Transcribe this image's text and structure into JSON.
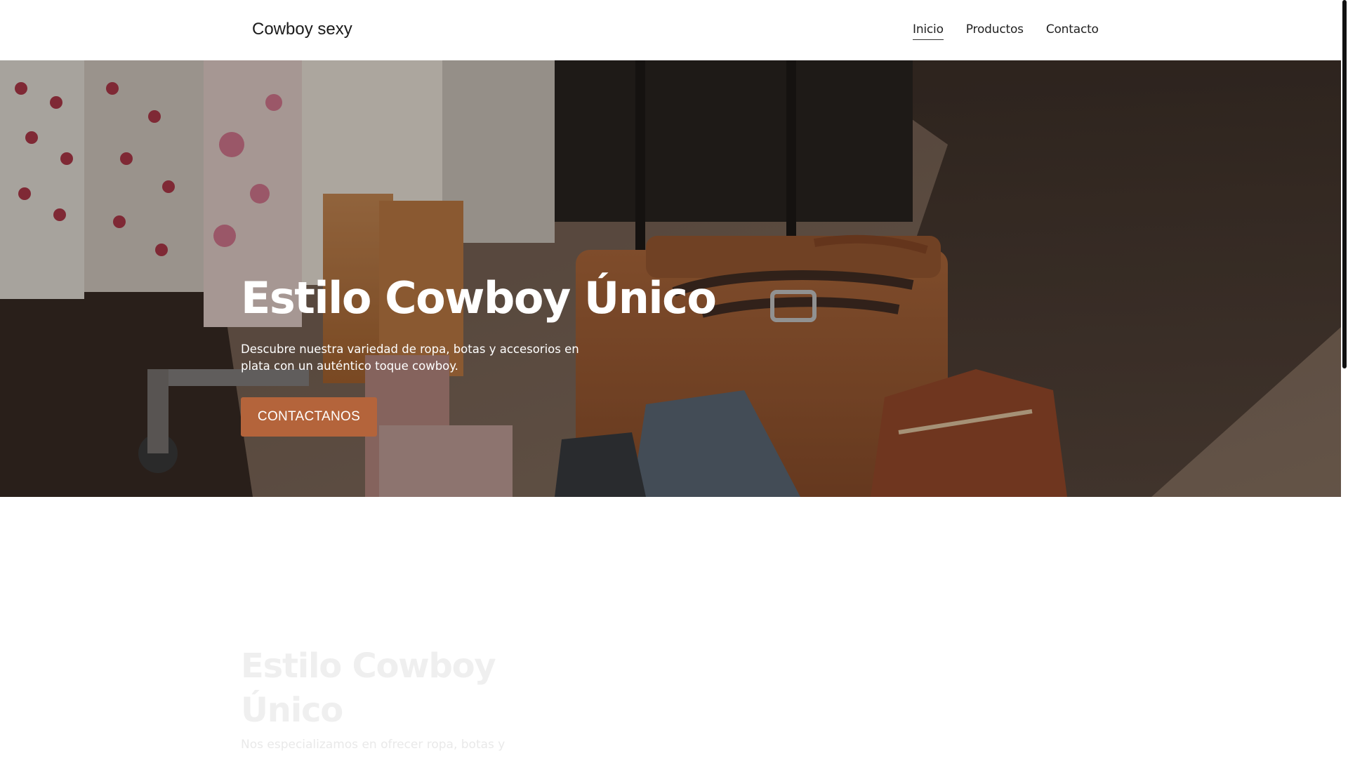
{
  "header": {
    "brand": "Cowboy sexy",
    "nav": [
      {
        "label": "Inicio",
        "active": true
      },
      {
        "label": "Productos",
        "active": false
      },
      {
        "label": "Contacto",
        "active": false
      }
    ]
  },
  "hero": {
    "title": "Estilo Cowboy Único",
    "description": "Descubre nuestra variedad de ropa, botas y accesorios en plata con un auténtico toque cowboy.",
    "cta_label": "CONTACTANOS",
    "cta_color": "#b4643b",
    "image_alt": "background-photo"
  },
  "section2": {
    "title": "Estilo Cowboy Único",
    "description": "Nos especializamos en ofrecer ropa, botas y"
  }
}
